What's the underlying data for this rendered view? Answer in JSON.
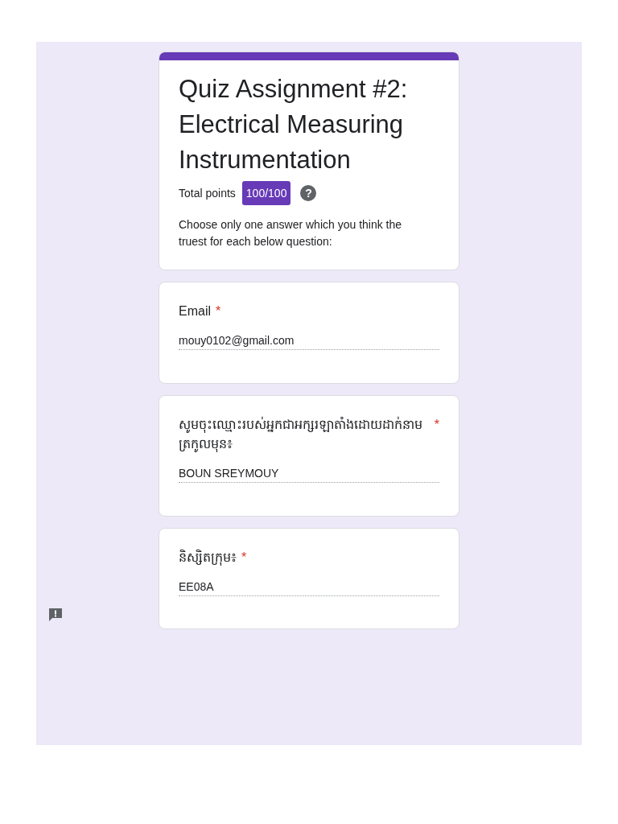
{
  "header": {
    "title": "Quiz Assignment #2: Electrical Measuring Instrumentation",
    "points_label": "Total points",
    "points": "100/100",
    "help": "?",
    "description": "Choose only one answer which you think the truest for each below question:"
  },
  "asterisk": "*",
  "questions": [
    {
      "title": "Email",
      "required": true,
      "value": "mouy0102@gmail.com"
    },
    {
      "title": "សូមចុះឈ្មោះរបស់អ្នកជាអក្សរឡាតាំងដោយដាក់នាមត្រកូលមុន៖",
      "required": true,
      "value": "BOUN SREYMOUY"
    },
    {
      "title": "និស្សិតក្រុម៖",
      "required": true,
      "value": "EE08A"
    }
  ]
}
